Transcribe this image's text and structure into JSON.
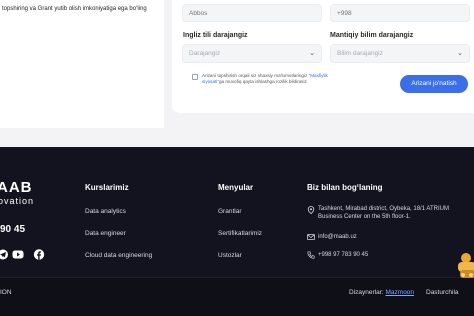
{
  "left_panel": {
    "text": "topshiring va Grant yutib olish imkoniyatiga ega bo‘ling"
  },
  "form": {
    "top_left_placeholder": "Abbos",
    "top_right_placeholder": "+998",
    "english_label": "Ingliz tili darajangiz",
    "english_placeholder": "Darajangiz",
    "math_label": "Mantiqiy bilim darajangiz",
    "math_placeholder": "Bilim darajangiz",
    "consent_pre": "Arizani topshirish orqali siz shaxsiy ma'lumotlaringiz",
    "consent_link": "\"Maxfiylik siyosati\"",
    "consent_post": "ga muvofiq qayta ishlashga rozilik bildirasiz",
    "submit_label": "Arizani jo'natish"
  },
  "footer": {
    "logo_top": "AAB",
    "logo_bottom": "ovation",
    "phone_fragment": "90 45",
    "courses": {
      "title": "Kurslarimiz",
      "items": [
        "Data analytics",
        "Data engineer",
        "Cloud data engineering"
      ]
    },
    "menu": {
      "title": "Menyular",
      "items": [
        "Grantlar",
        "Sertifikatlarimiz",
        "Ustozlar"
      ]
    },
    "contact": {
      "title": "Biz bilan bog‘laning",
      "address": "Tashkent, Mirabad district, Oybeka, 18/1 ATRIUM Business Center on the 5th floor-1.",
      "email": "info@maab.uz",
      "phone": "+998 97 783 90 45"
    },
    "bottom_left": "ION",
    "designers_label": "Dizaynerlar:",
    "designers_link": "Mazmoon",
    "developers_fragment": "Dasturchila"
  },
  "colors": {
    "accent": "#3b6fe8",
    "footer_bg": "#13131f"
  },
  "icons": {
    "social": [
      "telegram-icon",
      "youtube-icon",
      "facebook-icon"
    ]
  }
}
